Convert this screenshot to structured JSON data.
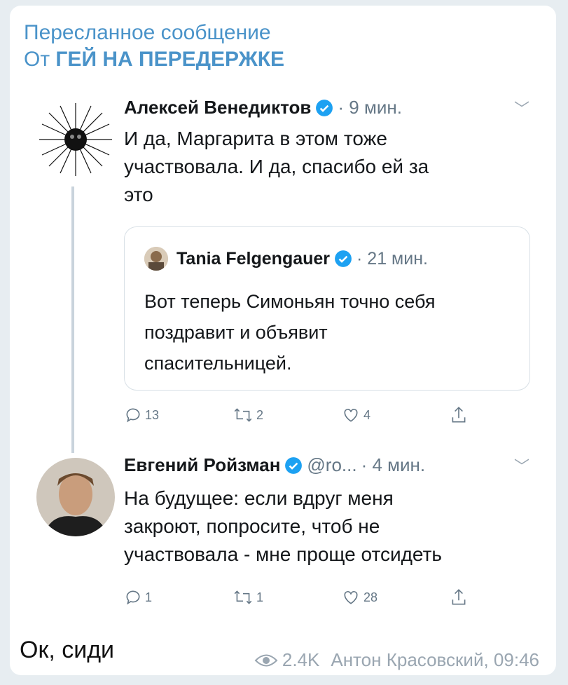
{
  "forward": {
    "header": "Пересланное сообщение",
    "from_prefix": "От",
    "from_name": "ГЕЙ НА ПЕРЕДЕРЖКЕ"
  },
  "tweet1": {
    "author": "Алексей Венедиктов",
    "time": "· 9 мин.",
    "text_lines": [
      "И да, Маргарита в этом тоже",
      "участвовала. И да, спасибо ей за",
      "это"
    ],
    "quote": {
      "author": "Tania Felgengauer",
      "time": "· 21 мин.",
      "text_lines": [
        "Вот теперь Симоньян точно себя",
        "поздравит и объявит",
        "спасительницей."
      ]
    },
    "actions": {
      "replies": "13",
      "retweets": "2",
      "likes": "4"
    }
  },
  "tweet2": {
    "author": "Евгений Ройзман",
    "handle": "@ro...",
    "time": "· 4 мин.",
    "text_lines": [
      "На будущее: если вдруг меня",
      "закроют, попросите, чтоб не",
      "участвовала - мне проще отсидеть"
    ],
    "actions": {
      "replies": "1",
      "retweets": "1",
      "likes": "28"
    }
  },
  "message": {
    "reply_text": "Ок, сиди",
    "views": "2.4K",
    "sender": "Антон Красовский, 09:46"
  },
  "colors": {
    "link_blue": "#4a93c9",
    "verified": "#1da1f2",
    "muted": "#657786"
  },
  "icons": [
    "verified-icon",
    "chevron-down-icon",
    "reply-icon",
    "retweet-icon",
    "like-icon",
    "share-icon",
    "eye-icon"
  ]
}
